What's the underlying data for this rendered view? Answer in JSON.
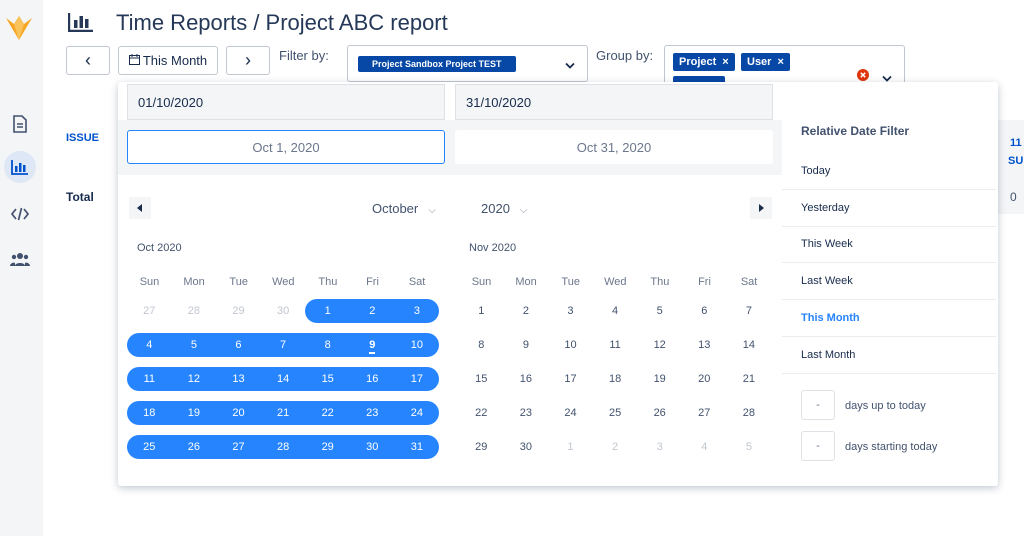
{
  "header": {
    "title": "Time Reports / Project ABC report"
  },
  "toolbar": {
    "prev": "‹",
    "period": "This Month",
    "next": "›",
    "filter_label": "Filter by:",
    "filter_value": "Project Sandbox Project TEST",
    "group_label": "Group by:",
    "group_tags": [
      "Project",
      "User"
    ],
    "tag_close": "×"
  },
  "table": {
    "col_issue": "ISSUE",
    "col_right_1": "11",
    "col_right_2": "SU",
    "total_label": "Total",
    "total_right": "0"
  },
  "datepicker": {
    "start_input": "01/10/2020",
    "end_input": "31/10/2020",
    "start_display": "Oct 1, 2020",
    "end_display": "Oct 31, 2020",
    "month_select": "October",
    "year_select": "2020",
    "weekdays": [
      "Sun",
      "Mon",
      "Tue",
      "Wed",
      "Thu",
      "Fri",
      "Sat"
    ],
    "left": {
      "caption": "Oct 2020",
      "weeks": [
        [
          "27",
          "28",
          "29",
          "30",
          "1",
          "2",
          "3"
        ],
        [
          "4",
          "5",
          "6",
          "7",
          "8",
          "9",
          "10"
        ],
        [
          "11",
          "12",
          "13",
          "14",
          "15",
          "16",
          "17"
        ],
        [
          "18",
          "19",
          "20",
          "21",
          "22",
          "23",
          "24"
        ],
        [
          "25",
          "26",
          "27",
          "28",
          "29",
          "30",
          "31"
        ]
      ]
    },
    "right": {
      "caption": "Nov 2020",
      "weeks": [
        [
          "1",
          "2",
          "3",
          "4",
          "5",
          "6",
          "7"
        ],
        [
          "8",
          "9",
          "10",
          "11",
          "12",
          "13",
          "14"
        ],
        [
          "15",
          "16",
          "17",
          "18",
          "19",
          "20",
          "21"
        ],
        [
          "22",
          "23",
          "24",
          "25",
          "26",
          "27",
          "28"
        ],
        [
          "29",
          "30",
          "1",
          "2",
          "3",
          "4",
          "5"
        ]
      ]
    }
  },
  "relative": {
    "title": "Relative Date Filter",
    "items": [
      "Today",
      "Yesterday",
      "This Week",
      "Last Week",
      "This Month",
      "Last Month"
    ],
    "active": "This Month",
    "days_up": "days up to today",
    "days_start": "days starting today",
    "placeholder": "-"
  },
  "colors": {
    "accent": "#2684ff",
    "brand": "#0747a6"
  }
}
